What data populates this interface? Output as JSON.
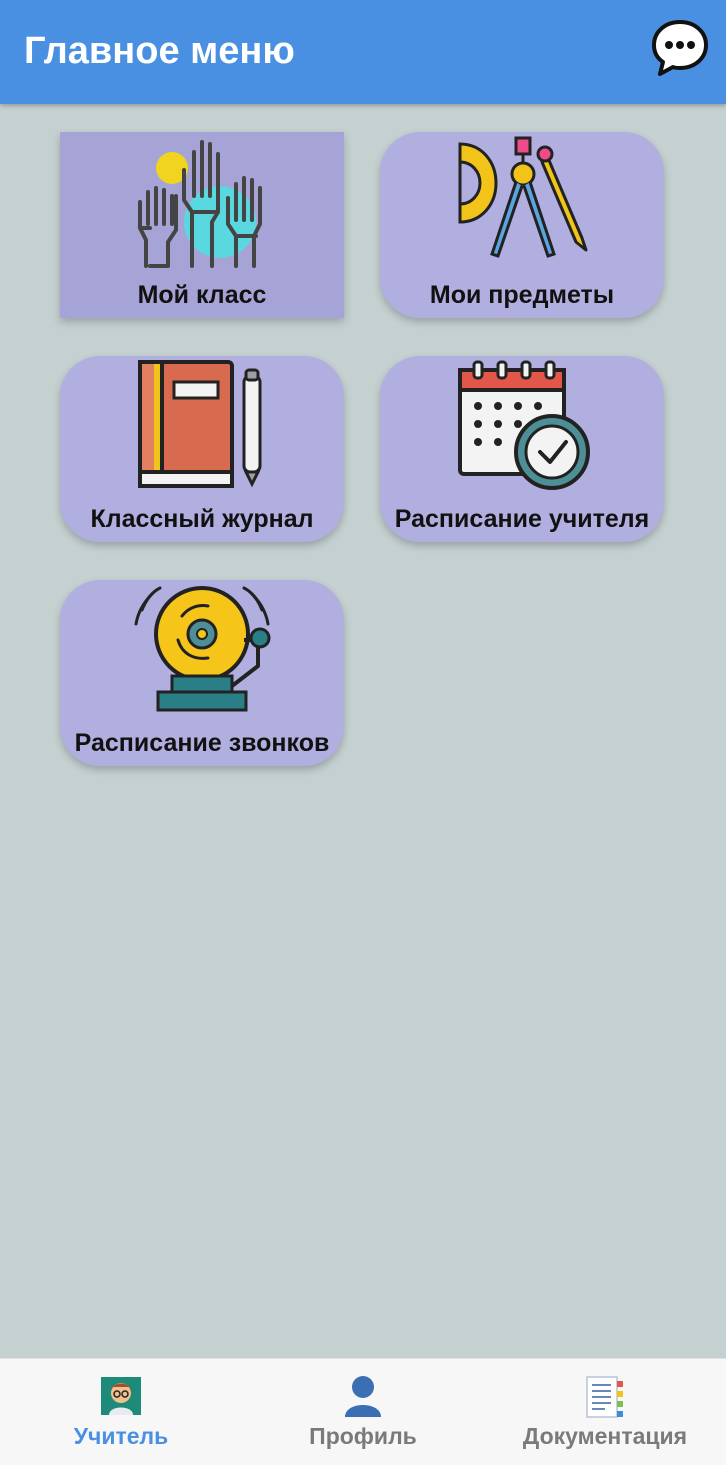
{
  "header": {
    "title": "Главное меню",
    "chat_icon": "chat-bubble-icon",
    "color": "#4a90e2"
  },
  "menu": {
    "tiles": [
      {
        "label": "Мой класс",
        "icon": "raised-hands-icon",
        "pressed": true
      },
      {
        "label": "Мои предметы",
        "icon": "drawing-tools-icon"
      },
      {
        "label": "Классный журнал",
        "icon": "journal-book-icon"
      },
      {
        "label": "Расписание учителя",
        "icon": "calendar-clock-icon"
      },
      {
        "label": "Расписание звонков",
        "icon": "school-bell-icon"
      }
    ],
    "tile_color": "#b0afe0",
    "background": "#c5d1d1"
  },
  "bottom_nav": {
    "items": [
      {
        "label": "Учитель",
        "icon": "teacher-icon",
        "active": true
      },
      {
        "label": "Профиль",
        "icon": "profile-icon"
      },
      {
        "label": "Документация",
        "icon": "document-icon"
      }
    ],
    "active_color": "#4a90e2"
  }
}
